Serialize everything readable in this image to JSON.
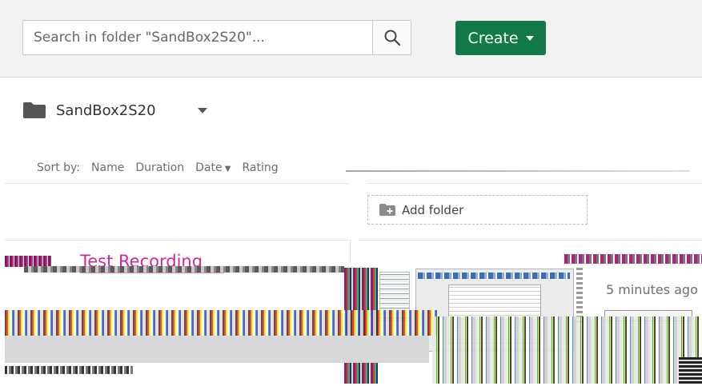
{
  "search": {
    "placeholder": "Search in folder \"SandBox2S20\"..."
  },
  "toolbar": {
    "create_label": "Create"
  },
  "folder": {
    "name": "SandBox2S20"
  },
  "sort": {
    "label": "Sort by:",
    "options": [
      "Name",
      "Duration",
      "Date",
      "Rating"
    ],
    "active": "Date"
  },
  "actions": {
    "add_folder_label": "Add folder"
  },
  "recording": {
    "title": "Test Recording",
    "time_ago": "5 minutes ago"
  },
  "colors": {
    "accent_green": "#127a48",
    "title_magenta": "#d0279a",
    "topbar_bg": "#f2f2f2"
  },
  "icons": {
    "search": "search-icon",
    "folder": "folder-icon",
    "add_folder": "folder-plus-icon",
    "dropdown": "chevron-down-icon"
  }
}
